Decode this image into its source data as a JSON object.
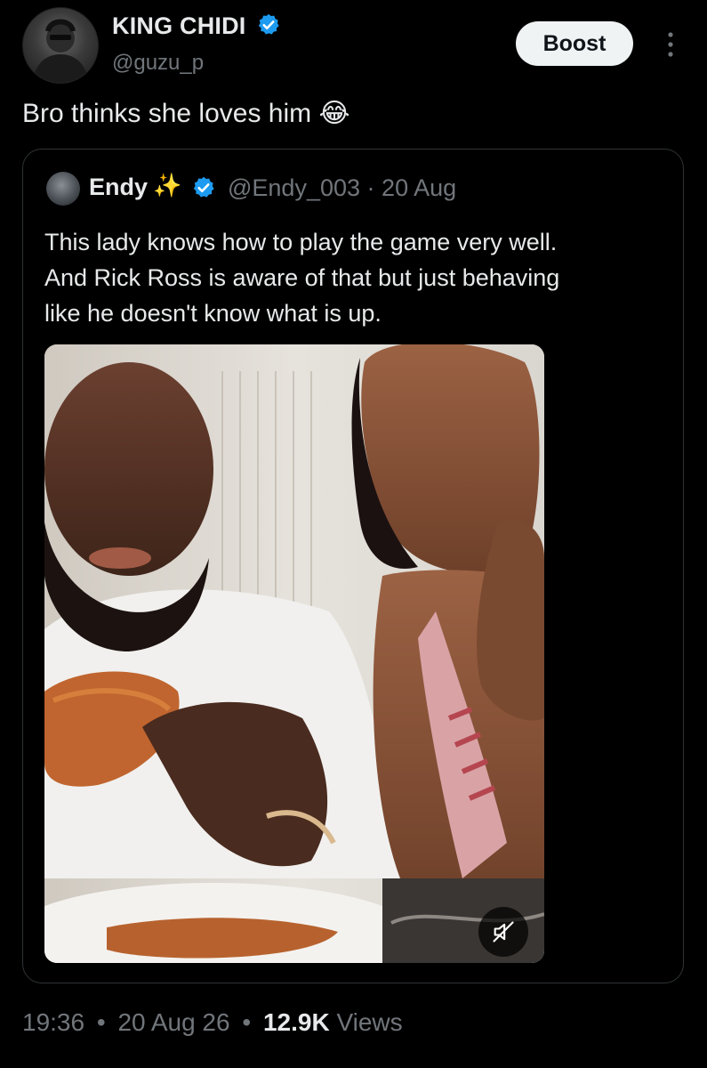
{
  "author": {
    "name": "KING CHIDI",
    "handle": "@guzu_p",
    "verified_color": "#1d9bf0"
  },
  "actions": {
    "boost_label": "Boost",
    "more_icon": "more-vertical-icon"
  },
  "tweet": {
    "text": "Bro thinks she loves him",
    "emoji": "😂"
  },
  "quoted": {
    "name": "Endy",
    "emoji": "✨",
    "handle": "@Endy_003",
    "separator": "·",
    "date": "20 Aug",
    "text": "This lady knows how to play the game very well.\nAnd Rick Ross is aware of that but just behaving\nlike he doesn't know what is up.",
    "media": {
      "type": "video",
      "muted_icon": "speaker-muted-icon"
    }
  },
  "meta": {
    "time": "19:36",
    "sep1": "•",
    "date": "20 Aug 26",
    "sep2": "•",
    "views_count": "12.9K",
    "views_label": "Views"
  }
}
